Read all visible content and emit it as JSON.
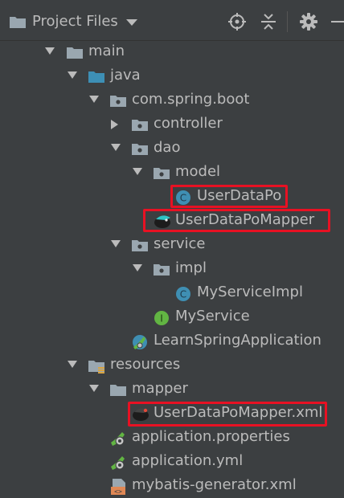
{
  "panel": {
    "title": "Project Files"
  },
  "tree": {
    "main": "main",
    "java": "java",
    "package": "com.spring.boot",
    "controller": "controller",
    "dao": "dao",
    "model": "model",
    "user_data_po": "UserDataPo",
    "user_data_po_mapper": "UserDataPoMapper",
    "service": "service",
    "impl": "impl",
    "my_service_impl": "MyServiceImpl",
    "my_service": "MyService",
    "learn_spring_application": "LearnSpringApplication",
    "resources": "resources",
    "mapper": "mapper",
    "user_data_po_mapper_xml": "UserDataPoMapper.xml",
    "application_properties": "application.properties",
    "application_yml": "application.yml",
    "mybatis_generator_xml": "mybatis-generator.xml"
  },
  "colors": {
    "background": "#3c3f41",
    "text": "#bbbbbb",
    "highlight": "#e81123",
    "class_icon": "#3f8fb3",
    "interface_icon": "#62b543"
  },
  "icons": {
    "panel": "folder-icon",
    "dropdown": "caret-down-icon",
    "locate": "crosshair-icon",
    "collapse": "collapse-all-icon",
    "settings": "gear-icon",
    "hide": "minimize-icon"
  }
}
